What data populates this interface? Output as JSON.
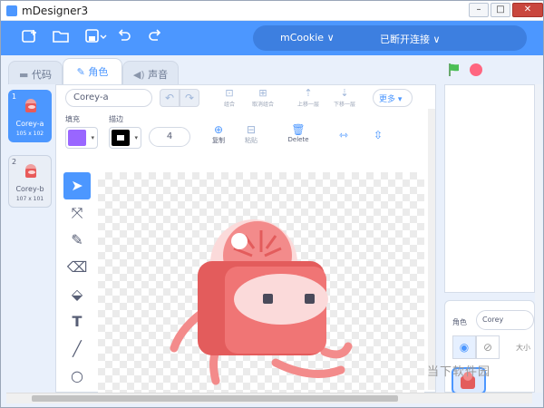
{
  "window": {
    "title": "mDesigner3"
  },
  "toolbar": {
    "device": "mCookie",
    "connection": "已断开连接"
  },
  "tabs": [
    {
      "label": "代码",
      "icon": "code-icon"
    },
    {
      "label": "角色",
      "icon": "brush-icon"
    },
    {
      "label": "声音",
      "icon": "sound-icon"
    }
  ],
  "sprites": [
    {
      "index": "1",
      "name": "Corey-a",
      "size": "105 x 102"
    },
    {
      "index": "2",
      "name": "Corey-b",
      "size": "107 x 101"
    }
  ],
  "editor": {
    "costume_name": "Corey-a",
    "group_label": "组合",
    "ungroup_label": "取消组合",
    "forward_label": "上移一层",
    "backward_label": "下移一层",
    "more_label": "更多",
    "fill_label": "填充",
    "outline_label": "描边",
    "outline_width": "4",
    "copy_label": "复制",
    "paste_label": "粘贴",
    "delete_label": "Delete"
  },
  "sprite_info": {
    "label": "角色",
    "name": "Corey",
    "size_label": "大小"
  },
  "watermark": "当下软件园",
  "colors": {
    "accent": "#4c97ff",
    "fill": "#9966ff",
    "outline": "#000000",
    "go": "#4cbf56",
    "stop": "#ff6680"
  }
}
